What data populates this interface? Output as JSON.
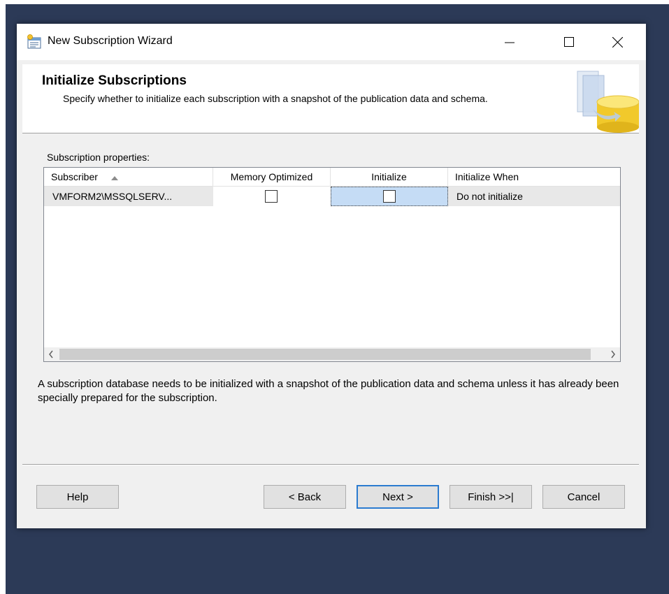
{
  "window": {
    "title": "New Subscription Wizard"
  },
  "header": {
    "title": "Initialize Subscriptions",
    "description": "Specify whether to initialize each subscription with a snapshot of the publication data and schema."
  },
  "grid": {
    "label": "Subscription properties:",
    "columns": [
      "Subscriber",
      "Memory Optimized",
      "Initialize",
      "Initialize When"
    ],
    "sort_column": "Subscriber",
    "rows": [
      {
        "subscriber": "VMFORM2\\MSSQLSERV...",
        "memory_optimized": false,
        "initialize": false,
        "initialize_when": "Do not initialize"
      }
    ]
  },
  "info": {
    "text": "A subscription database needs to be initialized with a snapshot of the publication data and schema unless it has already been specially prepared for the subscription."
  },
  "buttons": {
    "help": "Help",
    "back": "< Back",
    "next": "Next >",
    "finish": "Finish >>|",
    "cancel": "Cancel"
  },
  "icons": {
    "app": "wizard-app-icon",
    "header": "database-icon",
    "sort": "sort-ascending-icon",
    "scroll_left": "chevron-left-icon",
    "scroll_right": "chevron-right-icon"
  },
  "colors": {
    "desktop": "#2c3a57",
    "dialog": "#f0f0f0",
    "selected_cell": "#c5dcf5",
    "default_button_border": "#2b7bd0"
  }
}
